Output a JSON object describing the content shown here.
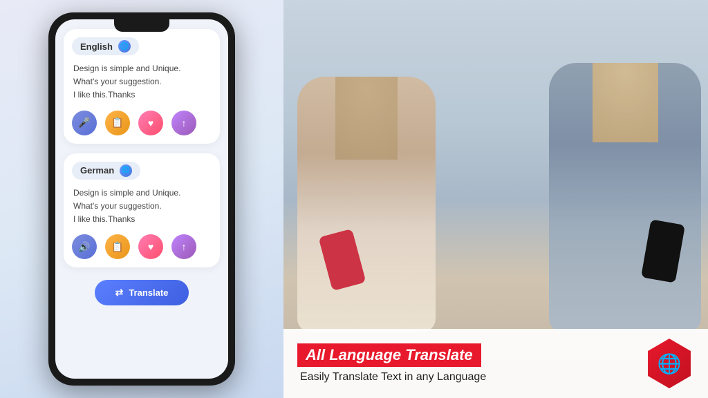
{
  "phone": {
    "source_card": {
      "language": "English",
      "text_line1": "Design is simple and Unique.",
      "text_line2": "What's your suggestion.",
      "text_line3": "I like this.Thanks"
    },
    "target_card": {
      "language": "German",
      "text_line1": "Design is simple and Unique.",
      "text_line2": "What's your suggestion.",
      "text_line3": "I like this.Thanks"
    },
    "translate_button": "Translate",
    "actions": {
      "mic": "🎤",
      "copy": "📋",
      "heart": "❤",
      "share": "⬆",
      "speaker": "🔊"
    }
  },
  "banner": {
    "title": "All Language Translate",
    "subtitle": "Easily Translate Text in any  Language",
    "globe_icon": "🌐"
  }
}
